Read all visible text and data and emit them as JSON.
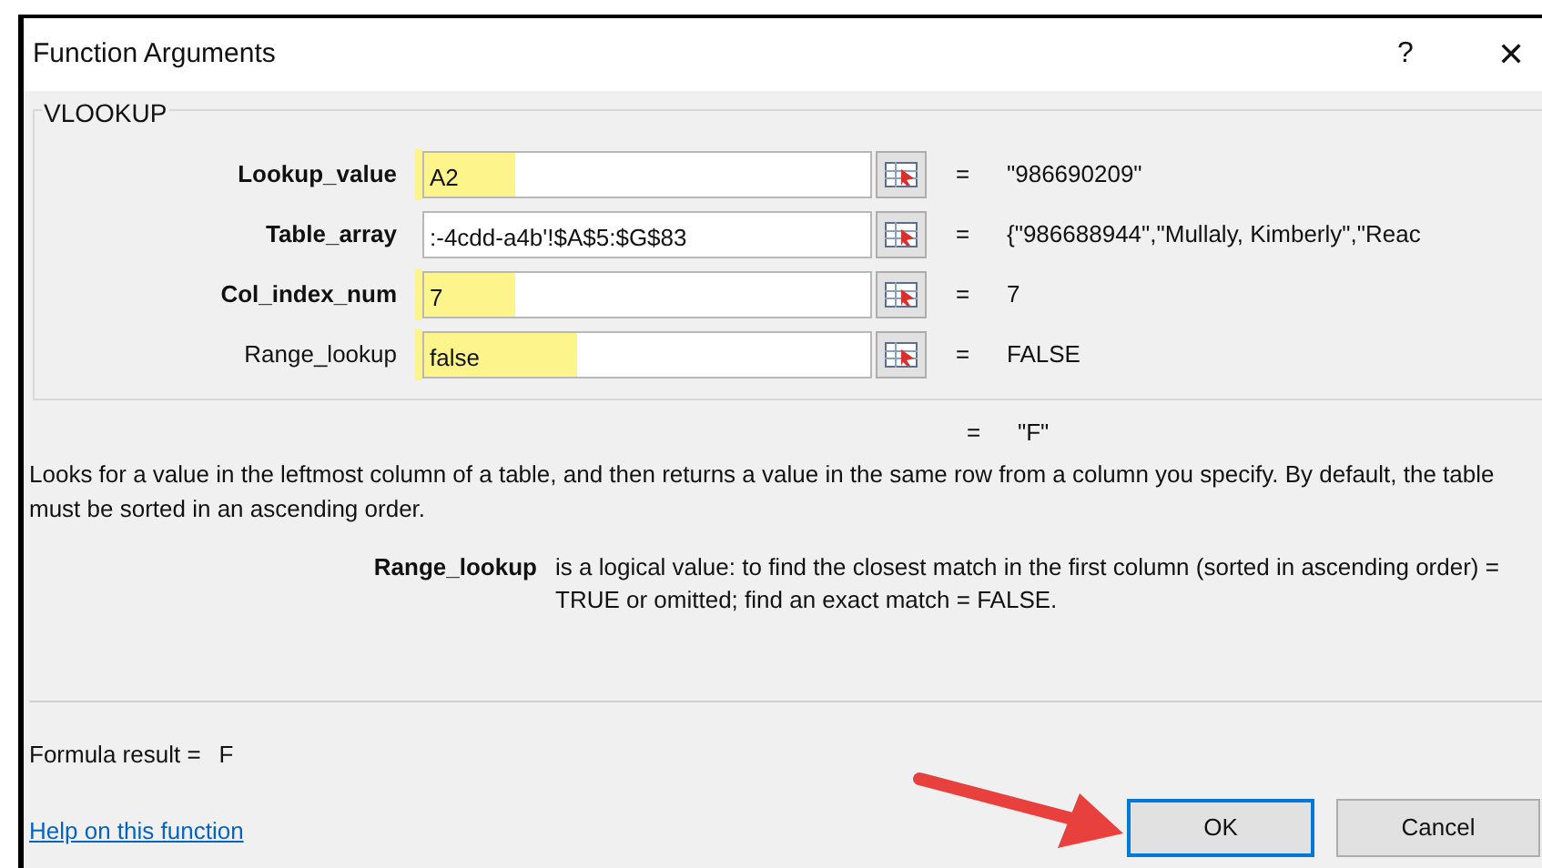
{
  "window": {
    "title": "Function Arguments",
    "help_button": "?",
    "close_button": "✕"
  },
  "function_group": {
    "name": "VLOOKUP",
    "arguments": [
      {
        "label": "Lookup_value",
        "required": true,
        "value": "A2",
        "highlighted": true,
        "equals": "=",
        "result": "\"986690209\""
      },
      {
        "label": "Table_array",
        "required": true,
        "value": ":-4cdd-a4b'!$A$5:$G$83",
        "highlighted": false,
        "equals": "=",
        "result": "{\"986688944\",\"Mullaly, Kimberly\",\"Reac"
      },
      {
        "label": "Col_index_num",
        "required": true,
        "value": "7",
        "highlighted": true,
        "equals": "=",
        "result": "7"
      },
      {
        "label": "Range_lookup",
        "required": false,
        "value": "false",
        "highlighted": true,
        "equals": "=",
        "result": "FALSE"
      }
    ]
  },
  "overall_equals": "=",
  "overall_result": "\"F\"",
  "description": "Looks for a value in the leftmost column of a table, and then returns a value in the same row from a column you specify. By default, the table must be sorted in an ascending order.",
  "argument_help": {
    "name": "Range_lookup",
    "text": "is a logical value: to find the closest match in the first column (sorted in ascending order) = TRUE or omitted; find an exact match = FALSE."
  },
  "formula_result": {
    "label": "Formula result =",
    "value": "F"
  },
  "help_link": "Help on this function",
  "buttons": [
    {
      "label": "OK",
      "selected": true
    },
    {
      "label": "Cancel",
      "selected": false
    }
  ]
}
